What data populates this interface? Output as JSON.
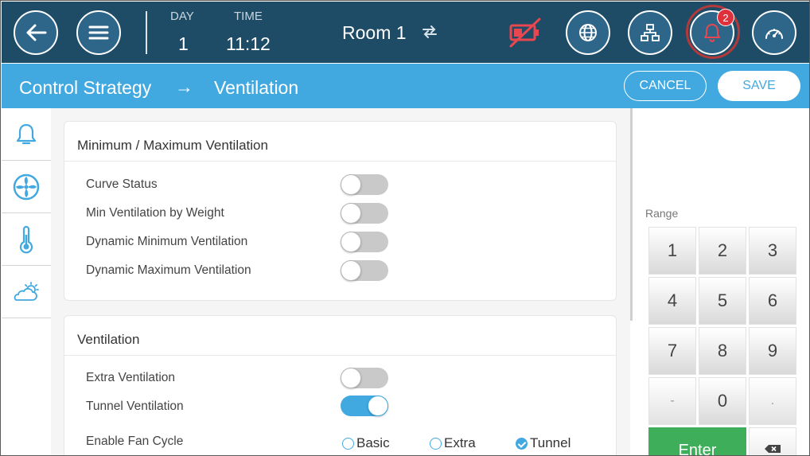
{
  "header": {
    "day_label": "DAY",
    "day_value": "1",
    "time_label": "TIME",
    "time_value": "11:12",
    "room_title": "Room 1",
    "alarm_count": "2",
    "icons": [
      "back-arrow-icon",
      "hamburger-menu-icon",
      "swap-arrows-icon",
      "battery-warning-icon",
      "globe-icon",
      "network-icon",
      "bell-icon",
      "gauge-icon"
    ],
    "colors": {
      "bar": "#1e4b66",
      "button": "#2d6689",
      "alarm_badge": "#e0303b",
      "battery_warning": "#e8474f"
    }
  },
  "breadcrumb": {
    "parent": "Control Strategy",
    "arrow": "→",
    "current": "Ventilation",
    "cancel_label": "CANCEL",
    "save_label": "SAVE",
    "color": "#42a9e0"
  },
  "sidenav": {
    "items": [
      {
        "icon": "bell-icon"
      },
      {
        "icon": "fan-icon"
      },
      {
        "icon": "thermometer-icon"
      },
      {
        "icon": "weather-icon"
      }
    ]
  },
  "minmax_card": {
    "title": "Minimum / Maximum Ventilation",
    "rows": [
      {
        "label": "Curve Status",
        "enabled": false
      },
      {
        "label": "Min Ventilation by Weight",
        "enabled": false
      },
      {
        "label": "Dynamic Minimum Ventilation",
        "enabled": false
      },
      {
        "label": "Dynamic Maximum Ventilation",
        "enabled": false
      }
    ]
  },
  "ventilation_card": {
    "title": "Ventilation",
    "rows": [
      {
        "label": "Extra Ventilation",
        "enabled": false
      },
      {
        "label": "Tunnel Ventilation",
        "enabled": true
      }
    ],
    "fan_cycle": {
      "label": "Enable Fan Cycle",
      "options": [
        "Basic",
        "Extra",
        "Tunnel"
      ],
      "selected": "Tunnel"
    }
  },
  "keypad": {
    "range_label": "Range",
    "keys": [
      "1",
      "2",
      "3",
      "4",
      "5",
      "6",
      "7",
      "8",
      "9",
      "-",
      "0",
      "."
    ],
    "enter_label": "Enter",
    "enter_color": "#3fae5a"
  }
}
